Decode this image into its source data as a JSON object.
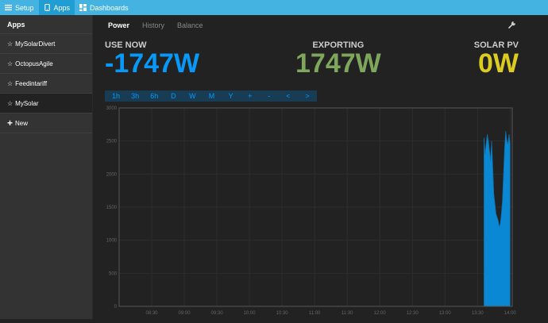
{
  "topbar": {
    "items": [
      {
        "label": "Setup",
        "icon": "menu-icon",
        "active": false
      },
      {
        "label": "Apps",
        "icon": "phone-icon",
        "active": true
      },
      {
        "label": "Dashboards",
        "icon": "grid-icon",
        "active": false
      }
    ]
  },
  "sidebar": {
    "title": "Apps",
    "items": [
      {
        "label": "MySolarDivert",
        "active": false
      },
      {
        "label": "OctopusAgile",
        "active": false
      },
      {
        "label": "Feedintariff",
        "active": false
      },
      {
        "label": "MySolar",
        "active": true
      }
    ],
    "new_label": "New"
  },
  "tabs": [
    {
      "label": "Power",
      "active": true
    },
    {
      "label": "History",
      "active": false
    },
    {
      "label": "Balance",
      "active": false
    }
  ],
  "stats": {
    "use_now": {
      "label": "USE NOW",
      "value": "-1747W",
      "color": "#0699fa"
    },
    "exporting": {
      "label": "EXPORTING",
      "value": "1747W",
      "color": "#7ea65c"
    },
    "solar_pv": {
      "label": "SOLAR PV",
      "value": "0W",
      "color": "#dccc1f"
    }
  },
  "ranges": [
    "1h",
    "3h",
    "6h",
    "D",
    "W",
    "M",
    "Y",
    "+",
    "-",
    "<",
    ">"
  ],
  "colors": {
    "topbar": "#44b3e2",
    "topbar_active": "#209ed3",
    "series": "#0a88d4"
  },
  "chart_data": {
    "type": "area",
    "title": "",
    "xlabel": "",
    "ylabel": "",
    "ylim": [
      0,
      3000
    ],
    "yticks": [
      0,
      500,
      1000,
      1500,
      2000,
      2500,
      3000
    ],
    "xticks": [
      "08:30",
      "09:00",
      "09:30",
      "10:00",
      "10:30",
      "11:00",
      "11:30",
      "12:00",
      "12:30",
      "13:00",
      "13:30",
      "14:00"
    ],
    "xlim_minutes": [
      480,
      842
    ],
    "grid": true,
    "series": [
      {
        "name": "",
        "x": [
          "13:36",
          "13:37",
          "13:38",
          "13:39",
          "13:40",
          "13:41",
          "13:42",
          "13:43",
          "13:44",
          "13:45",
          "13:46",
          "13:47",
          "13:48",
          "13:49",
          "13:50",
          "13:51",
          "13:52",
          "13:53",
          "13:54",
          "13:55",
          "13:56",
          "13:57",
          "13:58",
          "13:59",
          "14:00"
        ],
        "values": [
          2550,
          2300,
          2450,
          2600,
          2500,
          2350,
          2200,
          2500,
          2100,
          1700,
          1550,
          1400,
          1350,
          1300,
          1200,
          1250,
          1400,
          1600,
          2000,
          2400,
          2650,
          2500,
          2450,
          2600,
          2450
        ]
      }
    ]
  }
}
